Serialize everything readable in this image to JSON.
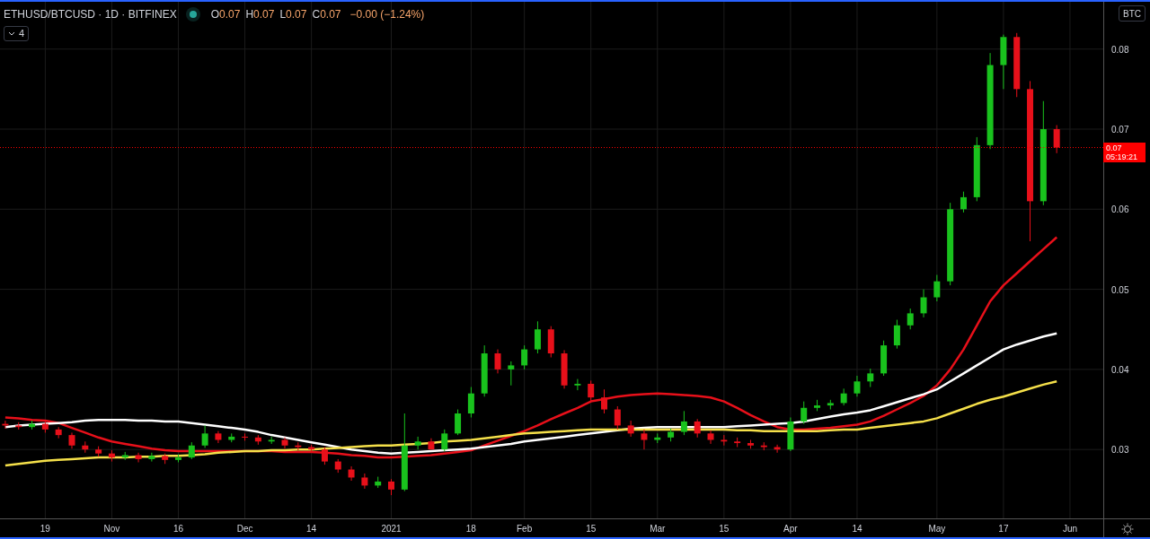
{
  "header": {
    "symbol": "ETHUSD/BTCUSD · 1D · BITFINEX",
    "legend": [
      {
        "label": "O",
        "value": "0.07"
      },
      {
        "label": "H",
        "value": "0.07"
      },
      {
        "label": "L",
        "value": "0.07"
      },
      {
        "label": "C",
        "value": "0.07"
      }
    ],
    "change": "−0.00 (−1.24%)",
    "indicators_toggle": "4"
  },
  "currency_button": "BTC",
  "last_price": {
    "price": "0.07",
    "countdown": "05:19:21"
  },
  "chart_data": {
    "type": "candlestick",
    "grid": true,
    "categories": [
      null,
      null,
      null,
      "19",
      null,
      null,
      null,
      null,
      "Nov",
      null,
      null,
      null,
      null,
      "16",
      null,
      null,
      null,
      null,
      "Dec",
      null,
      null,
      null,
      null,
      "14",
      null,
      null,
      null,
      null,
      null,
      "2021",
      null,
      null,
      null,
      null,
      null,
      "18",
      null,
      null,
      null,
      "Feb",
      null,
      null,
      null,
      null,
      "15",
      null,
      null,
      null,
      null,
      "Mar",
      null,
      null,
      null,
      null,
      "15",
      null,
      null,
      null,
      null,
      "Apr",
      null,
      null,
      null,
      null,
      "14",
      null,
      null,
      null,
      null,
      null,
      "May",
      null,
      null,
      null,
      null,
      "17",
      null,
      null,
      null,
      null,
      "Jun"
    ],
    "ylim": [
      0.0214,
      0.0859
    ],
    "yticks": [
      0.03,
      0.04,
      0.05,
      0.06,
      0.07,
      0.08
    ],
    "ref_lines": [
      {
        "axis": "y",
        "value": 0.0677,
        "color": "#ff0000"
      }
    ],
    "ohlc": [
      [
        0.0332,
        0.0336,
        0.0326,
        0.033
      ],
      [
        0.033,
        0.0334,
        0.0325,
        0.0328
      ],
      [
        0.0328,
        0.0336,
        0.0325,
        0.0332
      ],
      [
        0.0332,
        0.0335,
        0.0321,
        0.0325
      ],
      [
        0.0325,
        0.0328,
        0.0314,
        0.0318
      ],
      [
        0.0318,
        0.0321,
        0.0301,
        0.0305
      ],
      [
        0.0305,
        0.031,
        0.0296,
        0.03
      ],
      [
        0.03,
        0.0304,
        0.0291,
        0.0295
      ],
      [
        0.0295,
        0.0299,
        0.0285,
        0.029
      ],
      [
        0.029,
        0.0297,
        0.0287,
        0.0293
      ],
      [
        0.0293,
        0.0296,
        0.0284,
        0.0288
      ],
      [
        0.0288,
        0.0296,
        0.0285,
        0.0292
      ],
      [
        0.0292,
        0.0295,
        0.0282,
        0.0287
      ],
      [
        0.0287,
        0.0294,
        0.0284,
        0.029
      ],
      [
        0.029,
        0.0309,
        0.0288,
        0.0305
      ],
      [
        0.0305,
        0.033,
        0.0302,
        0.032
      ],
      [
        0.032,
        0.0323,
        0.0308,
        0.0312
      ],
      [
        0.0312,
        0.032,
        0.0309,
        0.0316
      ],
      [
        0.0316,
        0.032,
        0.0311,
        0.0315
      ],
      [
        0.0315,
        0.0318,
        0.0306,
        0.031
      ],
      [
        0.031,
        0.0316,
        0.0307,
        0.0312
      ],
      [
        0.0312,
        0.0315,
        0.0301,
        0.0305
      ],
      [
        0.0305,
        0.0309,
        0.0299,
        0.0303
      ],
      [
        0.0303,
        0.0306,
        0.0296,
        0.03
      ],
      [
        0.03,
        0.0303,
        0.0281,
        0.0285
      ],
      [
        0.0285,
        0.0288,
        0.0271,
        0.0275
      ],
      [
        0.0275,
        0.0279,
        0.0261,
        0.0265
      ],
      [
        0.0265,
        0.027,
        0.0251,
        0.0255
      ],
      [
        0.0255,
        0.0266,
        0.0252,
        0.026
      ],
      [
        0.026,
        0.0263,
        0.0243,
        0.025
      ],
      [
        0.025,
        0.0345,
        0.0248,
        0.0305
      ],
      [
        0.0305,
        0.0316,
        0.03,
        0.031
      ],
      [
        0.031,
        0.0314,
        0.03,
        0.03
      ],
      [
        0.03,
        0.0325,
        0.0298,
        0.032
      ],
      [
        0.032,
        0.035,
        0.0318,
        0.0345
      ],
      [
        0.0345,
        0.0378,
        0.034,
        0.037
      ],
      [
        0.037,
        0.043,
        0.0366,
        0.042
      ],
      [
        0.042,
        0.0425,
        0.0395,
        0.04
      ],
      [
        0.04,
        0.041,
        0.038,
        0.0405
      ],
      [
        0.0405,
        0.043,
        0.04,
        0.0425
      ],
      [
        0.0425,
        0.046,
        0.042,
        0.045
      ],
      [
        0.045,
        0.0454,
        0.0415,
        0.042
      ],
      [
        0.042,
        0.0424,
        0.0376,
        0.038
      ],
      [
        0.038,
        0.0388,
        0.0374,
        0.0382
      ],
      [
        0.0382,
        0.0386,
        0.036,
        0.0365
      ],
      [
        0.0365,
        0.0375,
        0.0345,
        0.035
      ],
      [
        0.035,
        0.0354,
        0.0325,
        0.033
      ],
      [
        0.033,
        0.0336,
        0.0316,
        0.032
      ],
      [
        0.032,
        0.0325,
        0.03,
        0.0312
      ],
      [
        0.0312,
        0.032,
        0.0308,
        0.0315
      ],
      [
        0.0315,
        0.0326,
        0.031,
        0.0322
      ],
      [
        0.0322,
        0.0348,
        0.0318,
        0.0335
      ],
      [
        0.0335,
        0.0338,
        0.0315,
        0.032
      ],
      [
        0.032,
        0.0324,
        0.0307,
        0.0312
      ],
      [
        0.0312,
        0.0318,
        0.0305,
        0.031
      ],
      [
        0.031,
        0.0315,
        0.0303,
        0.0308
      ],
      [
        0.0308,
        0.0312,
        0.0301,
        0.0305
      ],
      [
        0.0305,
        0.0309,
        0.0299,
        0.0303
      ],
      [
        0.0303,
        0.0306,
        0.0296,
        0.03
      ],
      [
        0.03,
        0.034,
        0.0298,
        0.0335
      ],
      [
        0.0335,
        0.036,
        0.0332,
        0.0352
      ],
      [
        0.0352,
        0.0362,
        0.0348,
        0.0355
      ],
      [
        0.0355,
        0.0362,
        0.035,
        0.0358
      ],
      [
        0.0358,
        0.0376,
        0.0355,
        0.037
      ],
      [
        0.037,
        0.0392,
        0.0366,
        0.0385
      ],
      [
        0.0385,
        0.0401,
        0.0378,
        0.0395
      ],
      [
        0.0395,
        0.0436,
        0.0392,
        0.043
      ],
      [
        0.043,
        0.0462,
        0.0426,
        0.0455
      ],
      [
        0.0455,
        0.0476,
        0.045,
        0.047
      ],
      [
        0.047,
        0.05,
        0.0465,
        0.049
      ],
      [
        0.049,
        0.0518,
        0.0485,
        0.051
      ],
      [
        0.051,
        0.0608,
        0.0505,
        0.06
      ],
      [
        0.06,
        0.0622,
        0.0596,
        0.0615
      ],
      [
        0.0615,
        0.069,
        0.061,
        0.068
      ],
      [
        0.068,
        0.0795,
        0.0675,
        0.078
      ],
      [
        0.078,
        0.0818,
        0.075,
        0.0815
      ],
      [
        0.0815,
        0.082,
        0.074,
        0.075
      ],
      [
        0.075,
        0.076,
        0.056,
        0.061
      ],
      [
        0.061,
        0.0735,
        0.0605,
        0.07
      ],
      [
        0.07,
        0.0705,
        0.067,
        0.0677
      ],
      null
    ],
    "series": [
      {
        "type": "line",
        "color": "#e8101a",
        "values": [
          0.034,
          0.0339,
          0.0337,
          0.0336,
          0.0333,
          0.0327,
          0.0321,
          0.0315,
          0.031,
          0.0307,
          0.0304,
          0.0301,
          0.0299,
          0.0298,
          0.0298,
          0.0298,
          0.0298,
          0.0298,
          0.0298,
          0.0298,
          0.0298,
          0.0297,
          0.0297,
          0.0297,
          0.0296,
          0.0295,
          0.0293,
          0.0292,
          0.029,
          0.029,
          0.0291,
          0.0292,
          0.0293,
          0.0295,
          0.0297,
          0.0299,
          0.0305,
          0.0311,
          0.0317,
          0.0323,
          0.033,
          0.0338,
          0.0345,
          0.0352,
          0.036,
          0.0363,
          0.0366,
          0.0368,
          0.0369,
          0.037,
          0.0369,
          0.0368,
          0.0367,
          0.0365,
          0.036,
          0.0352,
          0.0343,
          0.0335,
          0.0328,
          0.0325,
          0.0325,
          0.0326,
          0.0327,
          0.0329,
          0.0331,
          0.0335,
          0.0342,
          0.035,
          0.0358,
          0.0367,
          0.038,
          0.04,
          0.0425,
          0.0455,
          0.0485,
          0.0505,
          0.052,
          0.0535,
          0.055,
          0.0565,
          null
        ]
      },
      {
        "type": "line",
        "color": "#ffffff",
        "values": [
          0.0328,
          0.033,
          0.0331,
          0.0332,
          0.0333,
          0.0334,
          0.0336,
          0.0337,
          0.0337,
          0.0337,
          0.0336,
          0.0336,
          0.0335,
          0.0335,
          0.0333,
          0.0331,
          0.0329,
          0.0327,
          0.0325,
          0.0322,
          0.0318,
          0.0315,
          0.0312,
          0.0309,
          0.0306,
          0.0303,
          0.03,
          0.0298,
          0.0296,
          0.0295,
          0.0296,
          0.0297,
          0.0298,
          0.0299,
          0.03,
          0.0301,
          0.0303,
          0.0305,
          0.0307,
          0.031,
          0.0312,
          0.0314,
          0.0316,
          0.0318,
          0.032,
          0.0322,
          0.0324,
          0.0326,
          0.0327,
          0.0328,
          0.0328,
          0.0328,
          0.0328,
          0.0328,
          0.0328,
          0.0329,
          0.033,
          0.0331,
          0.0332,
          0.0333,
          0.0335,
          0.0338,
          0.0341,
          0.0344,
          0.0346,
          0.0349,
          0.0354,
          0.0359,
          0.0364,
          0.0369,
          0.0375,
          0.0385,
          0.0395,
          0.0405,
          0.0415,
          0.0425,
          0.0431,
          0.0436,
          0.0441,
          0.0445,
          null
        ]
      },
      {
        "type": "line",
        "color": "#f5e04a",
        "values": [
          0.028,
          0.0282,
          0.0284,
          0.0286,
          0.0287,
          0.0288,
          0.0289,
          0.029,
          0.029,
          0.029,
          0.0291,
          0.0291,
          0.0292,
          0.0292,
          0.0293,
          0.0294,
          0.0296,
          0.0297,
          0.0298,
          0.0298,
          0.0299,
          0.0299,
          0.03,
          0.03,
          0.0301,
          0.0302,
          0.0303,
          0.0304,
          0.0305,
          0.0305,
          0.0306,
          0.0307,
          0.0308,
          0.031,
          0.0311,
          0.0312,
          0.0314,
          0.0316,
          0.0318,
          0.032,
          0.0321,
          0.0322,
          0.0323,
          0.0324,
          0.0325,
          0.0325,
          0.0325,
          0.0325,
          0.0325,
          0.0325,
          0.0325,
          0.0325,
          0.0325,
          0.0325,
          0.0325,
          0.0324,
          0.0324,
          0.0323,
          0.0323,
          0.0323,
          0.0323,
          0.0323,
          0.0324,
          0.0325,
          0.0325,
          0.0327,
          0.0329,
          0.0331,
          0.0333,
          0.0335,
          0.0339,
          0.0345,
          0.0351,
          0.0357,
          0.0362,
          0.0366,
          0.0371,
          0.0376,
          0.0381,
          0.0385,
          null
        ]
      }
    ]
  }
}
